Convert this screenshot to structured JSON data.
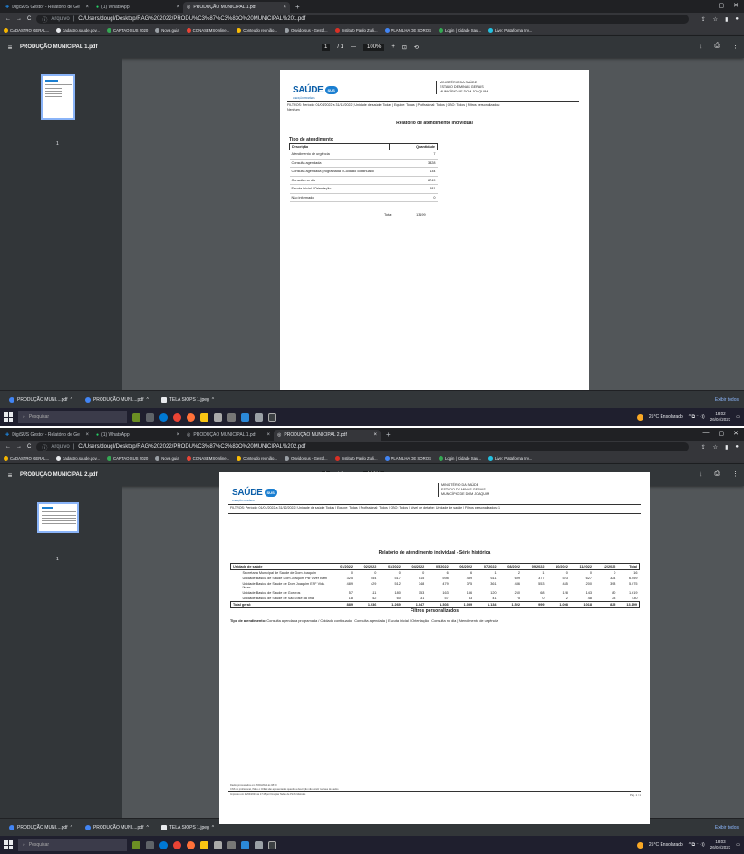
{
  "browser": {
    "tabs": [
      {
        "label": "DigiSUS Gestor - Relatório de Ge",
        "icon": "digisus-icon"
      },
      {
        "label": "(1) WhatsApp",
        "icon": "whatsapp-icon"
      },
      {
        "label": "PRODUÇÃO MUNICIPAL 1.pdf",
        "icon": "pdf-icon"
      },
      {
        "label": "PRODUÇÃO MUNICIPAL 2.pdf",
        "icon": "pdf-icon"
      }
    ],
    "url_prefix": "Arquivo",
    "url_1": "C:/Users/dougl/Desktop/RAG%202022/PRODU%C3%87%C3%83O%20MUNICIPAL%201.pdf",
    "url_2": "C:/Users/dougl/Desktop/RAG%202022/PRODU%C3%87%C3%83O%20MUNICIPAL%202.pdf",
    "bookmarks": [
      "CADASTRO GERAL...",
      "cadastro.saude.gov...",
      "CARTAO SUS 2020",
      "Nova guia",
      "CONASEMSOnline...",
      "Conteudo reunião...",
      "Ouvidorsus - Gestã...",
      "Instituto Paulo Zulli...",
      "PLANILHA DE SOROS",
      "Login | Cidade Sau...",
      "Live: Plataforma Inv..."
    ]
  },
  "viewer": {
    "title_1": "PRODUÇÃO MUNICIPAL 1.pdf",
    "title_2": "PRODUÇÃO MUNICIPAL 2.pdf",
    "page_num": "1",
    "page_total": "/ 1",
    "zoom": "100%",
    "thumb_num": "1"
  },
  "doc_header": {
    "logo_main": "SAÚDE",
    "logo_badge": "SUS",
    "logo_sub": "ATENÇÃO PRIMÁRIA",
    "ministry_1": "MINISTÉRIO DA SAÚDE",
    "ministry_2": "ESTADO DE MINAS GERAIS",
    "ministry_3": "MUNICÍPIO DE DOM JOAQUIM"
  },
  "report1": {
    "filters": "FILTROS: Período: 01/01/2022 a 31/12/2022 | Unidade de saúde: Todas | Equipe: Todas | Profissional: Todos | CBO: Todos | Filtros personalizados:",
    "filters_2": "Nenhum",
    "title": "Relatório de atendimento individual",
    "section": "Tipo de atendimento",
    "col_desc": "Descrição",
    "col_qty": "Quantidade",
    "rows": [
      {
        "desc": "Atendimento de urgência",
        "qty": "7"
      },
      {
        "desc": "Consulta agendada",
        "qty": "3828"
      },
      {
        "desc": "Consulta agendada programada / Cuidado continuado",
        "qty": "134"
      },
      {
        "desc": "Consulta no dia",
        "qty": "8749"
      },
      {
        "desc": "Escuta inicial / Orientação",
        "qty": "481"
      },
      {
        "desc": "Não informado",
        "qty": "0"
      }
    ],
    "total_label": "Total:",
    "total_value": "13199"
  },
  "report2": {
    "filters": "FILTROS: Período: 01/01/2022 a 31/12/2022 | Unidade de saúde: Todas | Equipe: Todas | Profissional: Todos | CBO: Todos | Nível de detalhe: Unidade de saúde | Filtros personalizados: 1",
    "title": "Relatório de atendimento individual - Série histórica",
    "col_unit": "Unidade de saúde",
    "months": [
      "01/2022",
      "02/2022",
      "03/2022",
      "04/2022",
      "05/2022",
      "06/2022",
      "07/2022",
      "08/2022",
      "09/2022",
      "10/2022",
      "11/2022",
      "12/2022",
      "Total"
    ],
    "rows": [
      {
        "name": "Secretaria Municipal de Saude de Dom Joaquim",
        "vals": [
          "0",
          "0",
          "0",
          "0",
          "6",
          "6",
          "1",
          "2",
          "1",
          "0",
          "0",
          "0",
          "16"
        ]
      },
      {
        "name": "Unidade Basica de Saude Dom Joaquim Psf Viver Bem",
        "vals": [
          "325",
          "454",
          "517",
          "515",
          "598",
          "489",
          "611",
          "699",
          "377",
          "523",
          "627",
          "324",
          "6.059"
        ]
      },
      {
        "name": "Unidade Basica de Saude de Dom Joaquim ESF Vida Nova",
        "vals": [
          "489",
          "429",
          "512",
          "348",
          "479",
          "375",
          "361",
          "486",
          "553",
          "445",
          "200",
          "398",
          "5.075"
        ]
      },
      {
        "name": "Unidade Basica de Saude de Gororos",
        "vals": [
          "57",
          "111",
          "180",
          "153",
          "163",
          "156",
          "120",
          "260",
          "68",
          "128",
          "143",
          "80",
          "1.619"
        ]
      },
      {
        "name": "Unidade Basica de Saude de Sao Jose da Ilha",
        "vals": [
          "18",
          "42",
          "60",
          "31",
          "57",
          "33",
          "41",
          "75",
          "0",
          "2",
          "48",
          "23",
          "430"
        ]
      }
    ],
    "total_label": "Total geral:",
    "total_vals": [
      "889",
      "1.036",
      "1.269",
      "1.047",
      "1.303",
      "1.059",
      "1.134",
      "1.522",
      "999",
      "1.098",
      "1.018",
      "825",
      "13.199"
    ],
    "custom_title": "Filtros personalizados",
    "custom_label": "Tipo de atendimento:",
    "custom_text": "Consulta agendada programada / Cuidado continuado | Consulta agendada | Escuta inicial / Orientação | Consulta no dia | Atendimento de urgência",
    "foot_1": "Dados processados em 26/04/2023 às 08:00",
    "foot_2": "CNS do profissional, INE e o CNES são apresentados quando a descrição não existir na base de dados",
    "foot_3": "Impresso em 26/04/2023 às 17:45 por Douglas Tadeu de Pinho Meireles",
    "page_label": "Pag. 1 / 1"
  },
  "downloads": {
    "items": [
      "PRODUÇÃO MUNI....pdf",
      "PRODUÇÃO MUNI....pdf",
      "TELA SIOPS 1.jpeg"
    ],
    "show_all": "Exibir todos"
  },
  "taskbar": {
    "search": "Pesquisar",
    "weather": "25°C Ensolarado",
    "time_1": "18:02",
    "time_2": "18:03",
    "date": "26/04/2023"
  }
}
